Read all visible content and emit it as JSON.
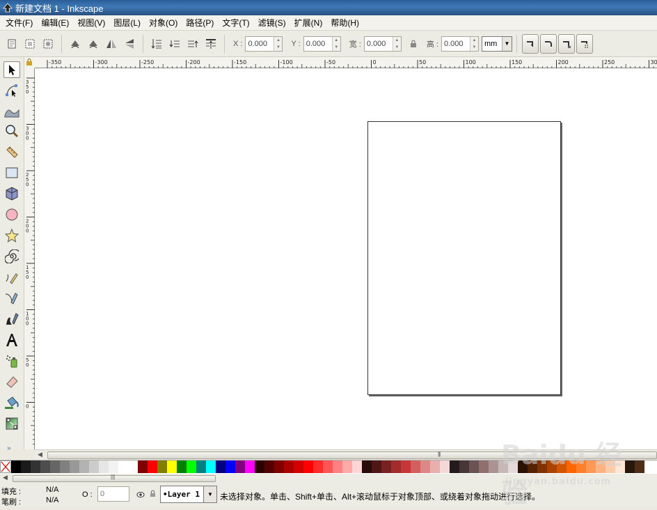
{
  "window": {
    "title": "新建文档 1 - Inkscape"
  },
  "menu": [
    {
      "label": "文件(F)"
    },
    {
      "label": "编辑(E)"
    },
    {
      "label": "视图(V)"
    },
    {
      "label": "图层(L)"
    },
    {
      "label": "对象(O)"
    },
    {
      "label": "路径(P)"
    },
    {
      "label": "文字(T)"
    },
    {
      "label": "滤镜(S)"
    },
    {
      "label": "扩展(N)"
    },
    {
      "label": "帮助(H)"
    }
  ],
  "toolbar": {
    "x_label": "X :",
    "x_value": "0.000",
    "y_label": "Y :",
    "y_value": "0.000",
    "w_label": "宽 :",
    "w_value": "0.000",
    "h_label": "高 :",
    "h_value": "0.000",
    "unit": "mm"
  },
  "ruler": {
    "h_ticks": [
      "-350",
      "-300",
      "-250",
      "-200",
      "-150",
      "-100",
      "-50",
      "0",
      "50",
      "100",
      "150",
      "200",
      "250",
      "300"
    ],
    "v_ticks": [
      "350",
      "300",
      "250",
      "200",
      "150",
      "100",
      "50",
      "0"
    ]
  },
  "tools": [
    {
      "name": "selector-tool",
      "icon": "arrow-icon",
      "active": true
    },
    {
      "name": "node-tool",
      "icon": "node-icon"
    },
    {
      "name": "tweak-tool",
      "icon": "wave-icon"
    },
    {
      "name": "zoom-tool",
      "icon": "magnifier-icon"
    },
    {
      "name": "measure-tool",
      "icon": "ruler-icon"
    },
    {
      "name": "rectangle-tool",
      "icon": "rectangle-icon"
    },
    {
      "name": "3dbox-tool",
      "icon": "cube-icon"
    },
    {
      "name": "ellipse-tool",
      "icon": "circle-icon"
    },
    {
      "name": "star-tool",
      "icon": "star-icon"
    },
    {
      "name": "spiral-tool",
      "icon": "spiral-icon"
    },
    {
      "name": "pencil-tool",
      "icon": "pencil-icon"
    },
    {
      "name": "pen-tool",
      "icon": "pen-icon"
    },
    {
      "name": "calligraphy-tool",
      "icon": "calligraphy-icon"
    },
    {
      "name": "text-tool",
      "icon": "text-icon"
    },
    {
      "name": "spray-tool",
      "icon": "spray-icon"
    },
    {
      "name": "eraser-tool",
      "icon": "eraser-icon"
    },
    {
      "name": "paint-bucket-tool",
      "icon": "bucket-icon"
    },
    {
      "name": "gradient-tool",
      "icon": "gradient-icon"
    }
  ],
  "more_tools": "»",
  "colors": {
    "page_border": "#333333",
    "palette": [
      "#000000",
      "#1a1a1a",
      "#333333",
      "#4d4d4d",
      "#666666",
      "#808080",
      "#999999",
      "#b3b3b3",
      "#cccccc",
      "#e6e6e6",
      "#f2f2f2",
      "#ffffff",
      "#ffffff",
      "#800000",
      "#ff0000",
      "#808000",
      "#ffff00",
      "#008000",
      "#00ff00",
      "#008080",
      "#00ffff",
      "#000080",
      "#0000ff",
      "#800080",
      "#ff00ff",
      "#2b0000",
      "#550000",
      "#800000",
      "#aa0000",
      "#d40000",
      "#ff0000",
      "#ff2a2a",
      "#ff5555",
      "#ff8080",
      "#ffaaaa",
      "#ffd5d5",
      "#280b0b",
      "#501616",
      "#782121",
      "#a02c2c",
      "#c83737",
      "#d35f5f",
      "#de8787",
      "#e9afaf",
      "#f4d7d7",
      "#241c1c",
      "#483737",
      "#6c5353",
      "#916f6f",
      "#ac9393",
      "#c8b7b7",
      "#e3dbdb",
      "#2b1100",
      "#552200",
      "#803300",
      "#aa4400",
      "#d45500",
      "#ff6600",
      "#ff7f2a",
      "#ff9955",
      "#ffb380",
      "#ffccaa",
      "#ffe6d5",
      "#28170b",
      "#502d16"
    ]
  },
  "status": {
    "fill_label": "填充 :",
    "fill_value": "N/A",
    "stroke_label": "笔刷 :",
    "stroke_value": "N/A",
    "opacity_label": "O :",
    "opacity_value": "0",
    "layer": "•Layer 1",
    "message": "未选择对象。单击、Shift+单击、Alt+滚动鼠标于对象顶部、或绕着对象拖动进行选择。"
  },
  "watermark": {
    "logo": "Baidu 经验",
    "url": "jingyan.baidu.com"
  }
}
